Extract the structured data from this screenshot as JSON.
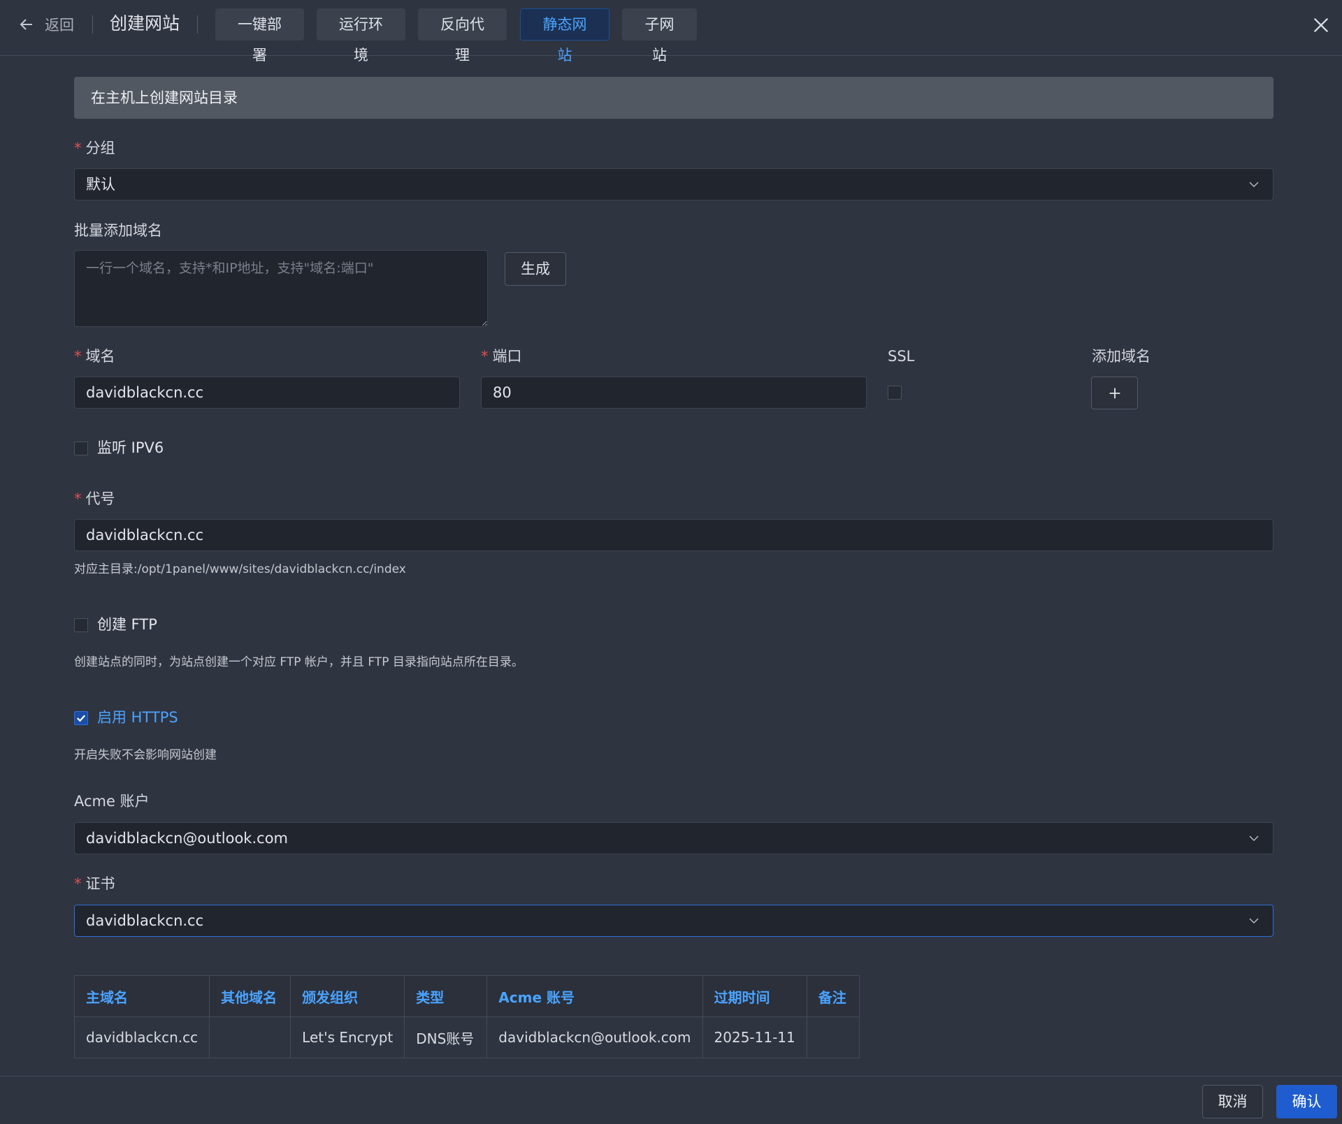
{
  "header": {
    "back_label": "返回",
    "title": "创建网站",
    "tabs": [
      {
        "label": "一键部署",
        "active": false
      },
      {
        "label": "运行环境",
        "active": false
      },
      {
        "label": "反向代理",
        "active": false
      },
      {
        "label": "静态网站",
        "active": true
      },
      {
        "label": "子网站",
        "active": false
      }
    ]
  },
  "form": {
    "banner": "在主机上创建网站目录",
    "group": {
      "label": "分组",
      "value": "默认"
    },
    "batch_domains": {
      "label": "批量添加域名",
      "placeholder": "一行一个域名，支持*和IP地址，支持\"域名:端口\"",
      "generate_label": "生成"
    },
    "domain": {
      "label": "域名",
      "value": "davidblackcn.cc"
    },
    "port": {
      "label": "端口",
      "value": "80"
    },
    "ssl": {
      "label": "SSL",
      "checked": false
    },
    "add_domain": {
      "label": "添加域名",
      "icon": "plus-icon"
    },
    "ipv6": {
      "label": "监听 IPV6",
      "checked": false
    },
    "alias": {
      "label": "代号",
      "value": "davidblackcn.cc",
      "hint": "对应主目录:/opt/1panel/www/sites/davidblackcn.cc/index"
    },
    "ftp": {
      "label": "创建 FTP",
      "checked": false,
      "hint": "创建站点的同时，为站点创建一个对应 FTP 帐户，并且 FTP 目录指向站点所在目录。"
    },
    "https": {
      "label": "启用 HTTPS",
      "checked": true,
      "hint": "开启失败不会影响网站创建"
    },
    "acme": {
      "label": "Acme 账户",
      "value": "davidblackcn@outlook.com"
    },
    "cert": {
      "label": "证书",
      "value": "davidblackcn.cc"
    }
  },
  "cert_table": {
    "headers": [
      "主域名",
      "其他域名",
      "颁发组织",
      "类型",
      "Acme 账号",
      "过期时间",
      "备注"
    ],
    "rows": [
      [
        "davidblackcn.cc",
        "",
        "Let's Encrypt",
        "DNS账号",
        "davidblackcn@outlook.com",
        "2025-11-11",
        ""
      ]
    ]
  },
  "footer": {
    "cancel_label": "取消",
    "confirm_label": "确认"
  },
  "colors": {
    "accent": "#4aa3ff",
    "primary_button": "#1f5ccf",
    "required": "#e0504f",
    "background": "#2f3441"
  }
}
